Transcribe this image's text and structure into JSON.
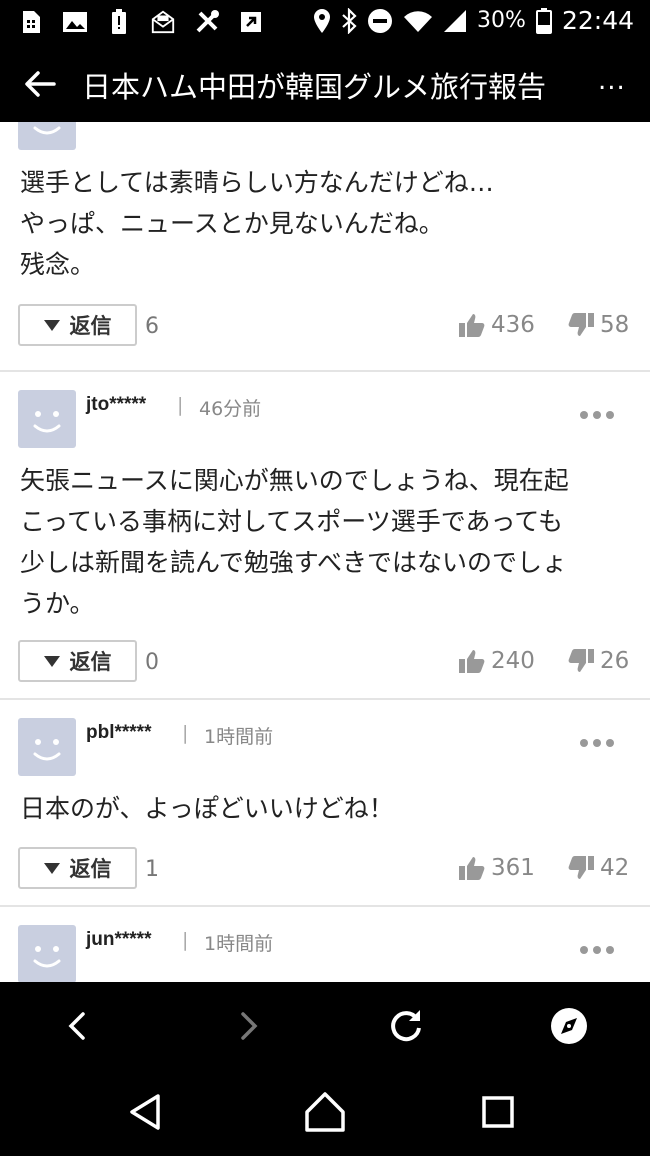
{
  "status_bar": {
    "battery": "30%",
    "time": "22:44"
  },
  "header": {
    "title": "日本ハム中田が韓国グルメ旅行報告",
    "more": "..."
  },
  "comments": [
    {
      "body_lines": [
        "選手としては素晴らしい方なんだけどね…",
        "やっぱ、ニュースとか見ないんだね。",
        "残念。"
      ],
      "reply_label": "返信",
      "reply_count": "6",
      "likes": "436",
      "dislikes": "58"
    },
    {
      "user": "jto*****",
      "separator": "|",
      "time": "46分前",
      "body_lines": [
        "矢張ニュースに関心が無いのでしょうね、現在起",
        "こっている事柄に対してスポーツ選手であっても",
        "少しは新聞を読んで勉強すべきではないのでしょ",
        "うか。"
      ],
      "reply_label": "返信",
      "reply_count": "0",
      "likes": "240",
      "dislikes": "26"
    },
    {
      "user": "pbl*****",
      "separator": "|",
      "time": "1時間前",
      "body_lines": [
        "日本のが、よっぽどいいけどね！"
      ],
      "reply_label": "返信",
      "reply_count": "1",
      "likes": "361",
      "dislikes": "42"
    },
    {
      "user": "jun*****",
      "separator": "|",
      "time": "1時間前"
    }
  ],
  "icons": {
    "status_left": [
      "sim-card-icon",
      "image-icon",
      "battery-alert-icon",
      "inbox-icon",
      "tools-icon",
      "export-icon"
    ],
    "status_right": [
      "location-icon",
      "bluetooth-icon",
      "do-not-disturb-icon",
      "wifi-icon",
      "signal-icon",
      "battery-icon"
    ],
    "browser": [
      "back-icon",
      "forward-icon",
      "reload-icon",
      "compass-icon"
    ],
    "nav": [
      "nav-back-icon",
      "home-icon",
      "recents-icon"
    ]
  },
  "colors": {
    "avatar": "#c9cfe0",
    "text": "#222222",
    "muted": "#888888"
  }
}
